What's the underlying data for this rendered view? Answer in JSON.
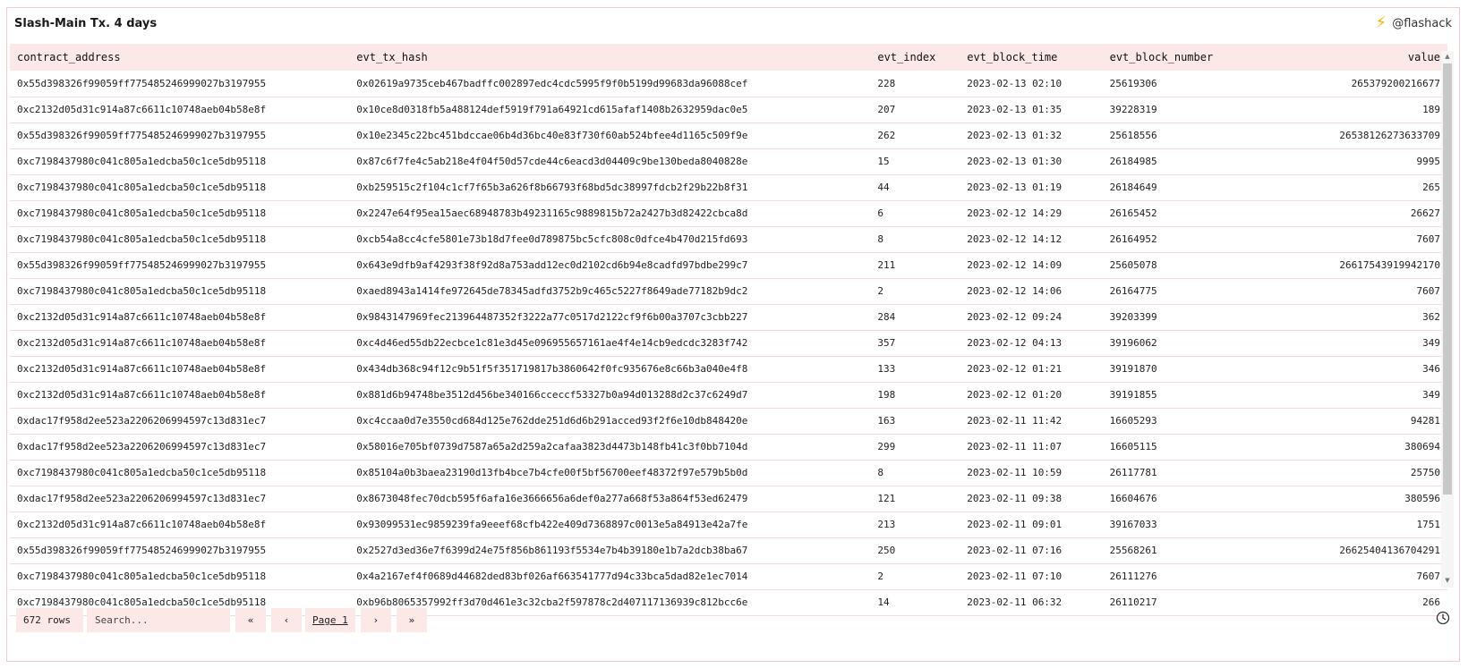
{
  "panel": {
    "title": "Slash-Main Tx. 4 days",
    "brand": "@flashack",
    "brand_icon": "bolt-icon"
  },
  "table": {
    "columns": [
      "contract_address",
      "evt_tx_hash",
      "evt_index",
      "evt_block_time",
      "evt_block_number",
      "value"
    ],
    "rows": [
      [
        "0x55d398326f99059ff775485246999027b3197955",
        "0x02619a9735ceb467badffc002897edc4cdc5995f9f0b5199d99683da96088cef",
        "228",
        "2023-02-13 02:10",
        "25619306",
        "265379200216677"
      ],
      [
        "0xc2132d05d31c914a87c6611c10748aeb04b58e8f",
        "0x10ce8d0318fb5a488124def5919f791a64921cd615afaf1408b2632959dac0e5",
        "207",
        "2023-02-13 01:35",
        "39228319",
        "189"
      ],
      [
        "0x55d398326f99059ff775485246999027b3197955",
        "0x10e2345c22bc451bdccae06b4d36bc40e83f730f60ab524bfee4d1165c509f9e",
        "262",
        "2023-02-13 01:32",
        "25618556",
        "26538126273633709"
      ],
      [
        "0xc7198437980c041c805a1edcba50c1ce5db95118",
        "0x87c6f7fe4c5ab218e4f04f50d57cde44c6eacd3d04409c9be130beda8040828e",
        "15",
        "2023-02-13 01:30",
        "26184985",
        "9995"
      ],
      [
        "0xc7198437980c041c805a1edcba50c1ce5db95118",
        "0xb259515c2f104c1cf7f65b3a626f8b66793f68bd5dc38997fdcb2f29b22b8f31",
        "44",
        "2023-02-13 01:19",
        "26184649",
        "265"
      ],
      [
        "0xc7198437980c041c805a1edcba50c1ce5db95118",
        "0x2247e64f95ea15aec68948783b49231165c9889815b72a2427b3d82422cbca8d",
        "6",
        "2023-02-12 14:29",
        "26165452",
        "26627"
      ],
      [
        "0xc7198437980c041c805a1edcba50c1ce5db95118",
        "0xcb54a8cc4cfe5801e73b18d7fee0d789875bc5cfc808c0dfce4b470d215fd693",
        "8",
        "2023-02-12 14:12",
        "26164952",
        "7607"
      ],
      [
        "0x55d398326f99059ff775485246999027b3197955",
        "0x643e9dfb9af4293f38f92d8a753add12ec0d2102cd6b94e8cadfd97bdbe299c7",
        "211",
        "2023-02-12 14:09",
        "25605078",
        "26617543919942170"
      ],
      [
        "0xc7198437980c041c805a1edcba50c1ce5db95118",
        "0xaed8943a1414fe972645de78345adfd3752b9c465c5227f8649ade77182b9dc2",
        "2",
        "2023-02-12 14:06",
        "26164775",
        "7607"
      ],
      [
        "0xc2132d05d31c914a87c6611c10748aeb04b58e8f",
        "0x9843147969fec213964487352f3222a77c0517d2122cf9f6b00a3707c3cbb227",
        "284",
        "2023-02-12 09:24",
        "39203399",
        "362"
      ],
      [
        "0xc2132d05d31c914a87c6611c10748aeb04b58e8f",
        "0xc4d46ed55db22ecbce1c81e3d45e096955657161ae4f4e14cb9edcdc3283f742",
        "357",
        "2023-02-12 04:13",
        "39196062",
        "349"
      ],
      [
        "0xc2132d05d31c914a87c6611c10748aeb04b58e8f",
        "0x434db368c94f12c9b51f5f351719817b3860642f0fc935676e8c66b3a040e4f8",
        "133",
        "2023-02-12 01:21",
        "39191870",
        "346"
      ],
      [
        "0xc2132d05d31c914a87c6611c10748aeb04b58e8f",
        "0x881d6b94748be3512d456be340166cceccf53327b0a94d013288d2c37c6249d7",
        "198",
        "2023-02-12 01:20",
        "39191855",
        "349"
      ],
      [
        "0xdac17f958d2ee523a2206206994597c13d831ec7",
        "0xc4ccaa0d7e3550cd684d125e762dde251d6d6b291acced93f2f6e10db848420e",
        "163",
        "2023-02-11 11:42",
        "16605293",
        "94281"
      ],
      [
        "0xdac17f958d2ee523a2206206994597c13d831ec7",
        "0x58016e705bf0739d7587a65a2d259a2cafaa3823d4473b148fb41c3f0bb7104d",
        "299",
        "2023-02-11 11:07",
        "16605115",
        "380694"
      ],
      [
        "0xc7198437980c041c805a1edcba50c1ce5db95118",
        "0x85104a0b3baea23190d13fb4bce7b4cfe00f5bf56700eef48372f97e579b5b0d",
        "8",
        "2023-02-11 10:59",
        "26117781",
        "25750"
      ],
      [
        "0xdac17f958d2ee523a2206206994597c13d831ec7",
        "0x8673048fec70dcb595f6afa16e3666656a6def0a277a668f53a864f53ed62479",
        "121",
        "2023-02-11 09:38",
        "16604676",
        "380596"
      ],
      [
        "0xc2132d05d31c914a87c6611c10748aeb04b58e8f",
        "0x93099531ec9859239fa9eeef68cfb422e409d7368897c0013e5a84913e42a7fe",
        "213",
        "2023-02-11 09:01",
        "39167033",
        "1751"
      ],
      [
        "0x55d398326f99059ff775485246999027b3197955",
        "0x2527d3ed36e7f6399d24e75f856b861193f5534e7b4b39180e1b7a2dcb38ba67",
        "250",
        "2023-02-11 07:16",
        "25568261",
        "26625404136704291"
      ],
      [
        "0xc7198437980c041c805a1edcba50c1ce5db95118",
        "0x4a2167ef4f0689d44682ded83bf026af663541777d94c33bca5dad82e1ec7014",
        "2",
        "2023-02-11 07:10",
        "26111276",
        "7607"
      ],
      [
        "0xc7198437980c041c805a1edcba50c1ce5db95118",
        "0xb96b8065357992ff3d70d461e3c32cba2f597878c2d407117136939c812bcc6e",
        "14",
        "2023-02-11 06:32",
        "26110217",
        "266"
      ]
    ]
  },
  "footer": {
    "rows_count": "672 rows",
    "search_placeholder": "Search...",
    "first_icon": "«",
    "prev_icon": "‹",
    "page_label": "Page 1",
    "next_icon": "›",
    "last_icon": "»"
  },
  "colors": {
    "accent_bg": "#fde8e8",
    "border": "#f5c9c9",
    "bolt": "#f2b705"
  }
}
